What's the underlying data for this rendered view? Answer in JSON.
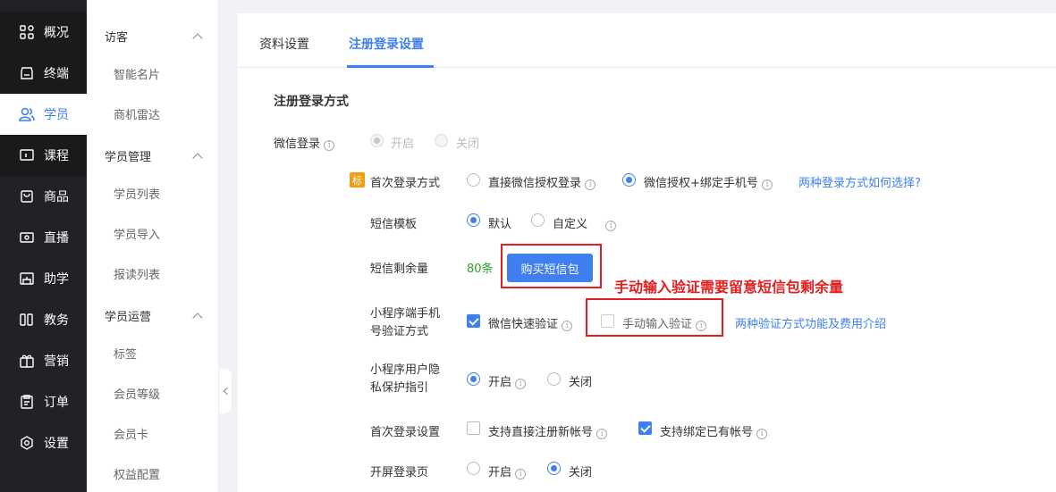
{
  "nav": {
    "items": [
      {
        "label": "概况",
        "icon": "grid-icon"
      },
      {
        "label": "终端",
        "icon": "store-icon"
      },
      {
        "label": "学员",
        "icon": "users-icon"
      },
      {
        "label": "课程",
        "icon": "course-icon"
      },
      {
        "label": "商品",
        "icon": "bag-icon"
      },
      {
        "label": "直播",
        "icon": "live-icon"
      },
      {
        "label": "助学",
        "icon": "study-icon"
      },
      {
        "label": "教务",
        "icon": "books-icon"
      },
      {
        "label": "营销",
        "icon": "gift-icon"
      },
      {
        "label": "订单",
        "icon": "order-icon"
      },
      {
        "label": "设置",
        "icon": "settings-icon"
      }
    ]
  },
  "subnav": {
    "groups": [
      {
        "label": "访客",
        "items": [
          "智能名片",
          "商机雷达"
        ]
      },
      {
        "label": "学员管理",
        "items": [
          "学员列表",
          "学员导入",
          "报读列表"
        ]
      },
      {
        "label": "学员运营",
        "items": [
          "标签",
          "会员等级",
          "会员卡",
          "权益配置"
        ]
      }
    ]
  },
  "tabs": [
    "资料设置",
    "注册登录设置"
  ],
  "section_title": "注册登录方式",
  "wechat_login": {
    "label": "微信登录",
    "options": [
      "开启",
      "关闭"
    ],
    "selected": "开启"
  },
  "first_login": {
    "badge": "标",
    "label": "首次登录方式",
    "options": [
      "直接微信授权登录",
      "微信授权+绑定手机号"
    ],
    "selected": "微信授权+绑定手机号",
    "help_link": "两种登录方式如何选择?"
  },
  "sms_template": {
    "label": "短信模板",
    "options": [
      "默认",
      "自定义"
    ],
    "selected": "默认"
  },
  "sms_remaining": {
    "label": "短信剩余量",
    "value": "80条",
    "buy_button": "购买短信包"
  },
  "annotation": "手动输入验证需要留意短信包剩余量",
  "mp_verify": {
    "label_line1": "小程序端手机",
    "label_line2": "号验证方式",
    "options": [
      "微信快速验证",
      "手动输入验证"
    ],
    "checked": [
      true,
      false
    ],
    "help_link": "两种验证方式功能及费用介绍"
  },
  "privacy": {
    "label_line1": "小程序用户隐",
    "label_line2": "私保护指引",
    "options": [
      "开启",
      "关闭"
    ],
    "selected": "开启"
  },
  "first_login_settings": {
    "label": "首次登录设置",
    "options": [
      "支持直接注册新帐号",
      "支持绑定已有帐号"
    ],
    "checked": [
      false,
      true
    ]
  },
  "splash_login": {
    "label": "开屏登录页",
    "options": [
      "开启",
      "关闭"
    ],
    "selected": "关闭"
  },
  "colors": {
    "accent": "#3f7ff0",
    "nav_bg": "#222226",
    "annotation_red": "#e02020",
    "green": "#2aa32a"
  }
}
